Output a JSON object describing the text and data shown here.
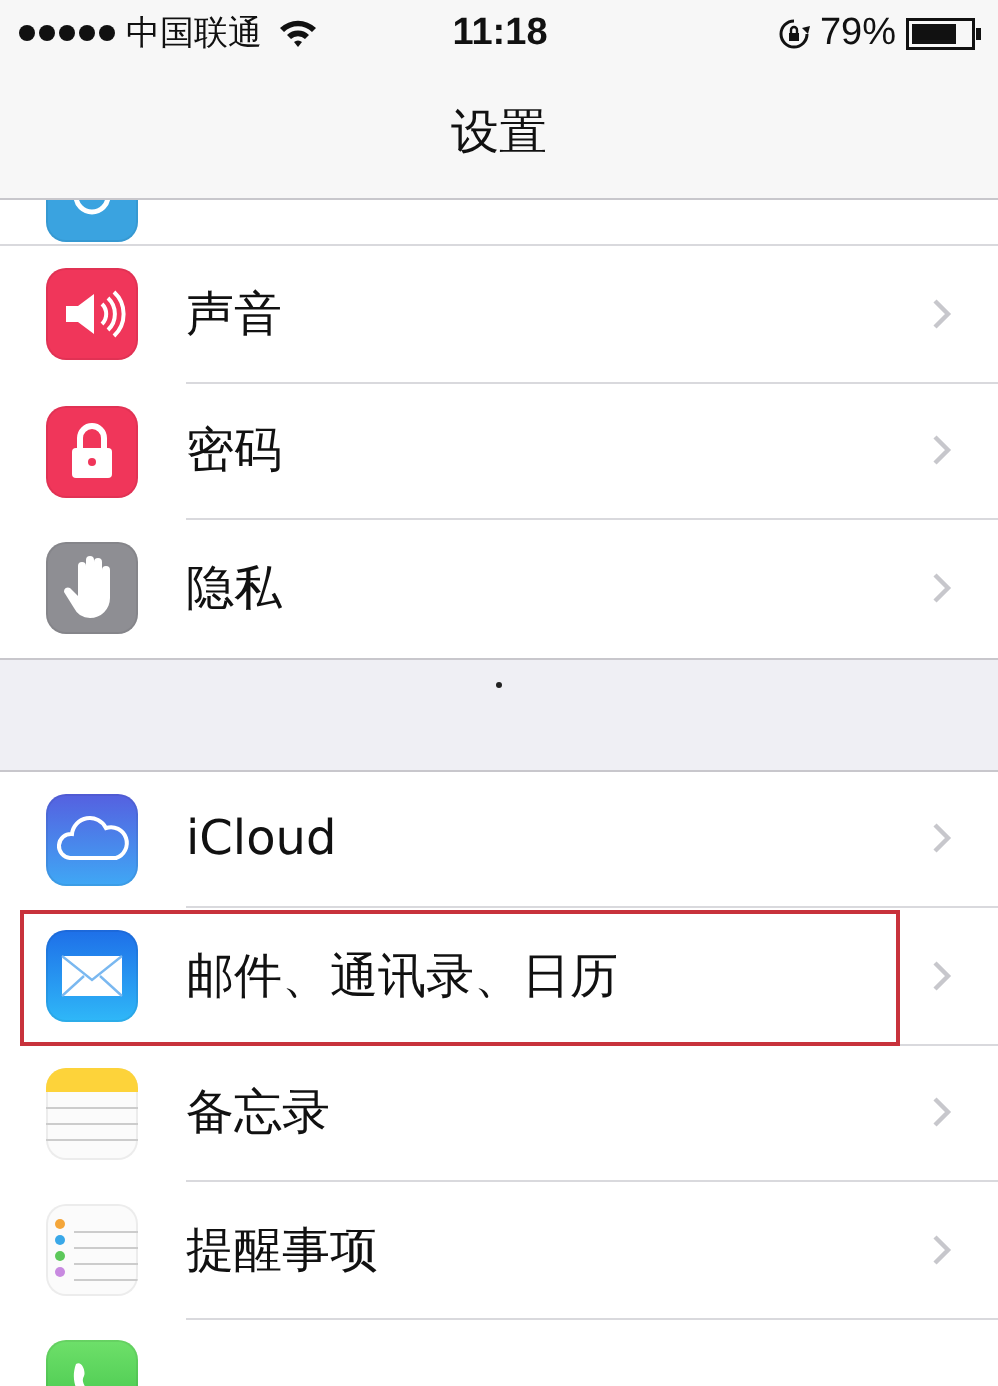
{
  "status_bar": {
    "carrier": "中国联通",
    "time": "11:18",
    "battery": "79%"
  },
  "nav": {
    "title": "设置"
  },
  "groups": [
    {
      "rows": [
        {
          "kind": "partial"
        },
        {
          "kind": "row",
          "label": "声音",
          "highlighted": false
        },
        {
          "kind": "row",
          "label": "密码",
          "highlighted": false
        },
        {
          "kind": "row",
          "label": "隐私",
          "highlighted": false
        }
      ]
    },
    {
      "rows": [
        {
          "kind": "row",
          "label": "iCloud",
          "highlighted": false
        },
        {
          "kind": "row",
          "label": "邮件、通讯录、日历",
          "highlighted": true
        },
        {
          "kind": "row",
          "label": "备忘录",
          "highlighted": false
        },
        {
          "kind": "row",
          "label": "提醒事项",
          "highlighted": false
        },
        {
          "kind": "cut"
        }
      ]
    }
  ]
}
